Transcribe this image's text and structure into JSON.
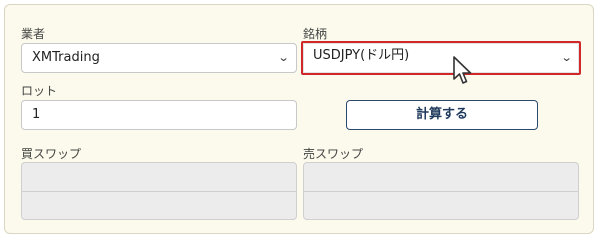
{
  "broker": {
    "label": "業者",
    "value": "XMTrading"
  },
  "symbol": {
    "label": "銘柄",
    "value": "USDJPY(ドル円)"
  },
  "lot": {
    "label": "ロット",
    "value": "1"
  },
  "calculate_button": "計算する",
  "buy_swap": {
    "label": "買スワップ",
    "value": ""
  },
  "sell_swap": {
    "label": "売スワップ",
    "value": ""
  },
  "colors": {
    "panel_bg": "#fbfaec",
    "highlight": "#d0272b",
    "button_text": "#1f3a5c"
  },
  "icons": {
    "dropdown": "chevron-down-icon",
    "cursor": "mouse-pointer-icon"
  }
}
